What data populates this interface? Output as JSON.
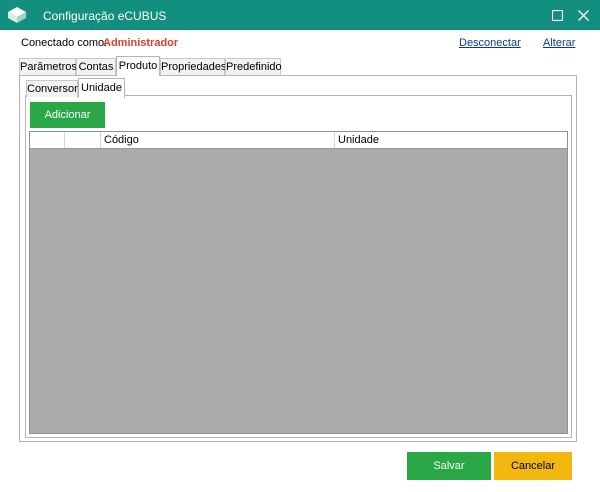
{
  "window": {
    "title": "Configuração eCUBUS",
    "accent_color": "#128f7e"
  },
  "connection": {
    "label": "Conectado como:",
    "user": "Administrador",
    "user_color": "#d6402f",
    "disconnect_link": "Desconectar",
    "alter_link": "Alterar"
  },
  "outer_tabs": [
    {
      "label": "Parâmetros",
      "active": false
    },
    {
      "label": "Contas",
      "active": false
    },
    {
      "label": "Produto",
      "active": true
    },
    {
      "label": "Propriedades",
      "active": false
    },
    {
      "label": "Predefinido",
      "active": false
    }
  ],
  "inner_tabs": [
    {
      "label": "Conversor",
      "active": false
    },
    {
      "label": "Unidade",
      "active": true
    }
  ],
  "toolbar": {
    "add_label": "Adicionar"
  },
  "grid": {
    "columns": [
      "",
      "",
      "Código",
      "Unidade"
    ],
    "rows": []
  },
  "footer": {
    "save_label": "Salvar",
    "cancel_label": "Cancelar",
    "save_color": "#2aa747",
    "cancel_color": "#f2b80f"
  }
}
